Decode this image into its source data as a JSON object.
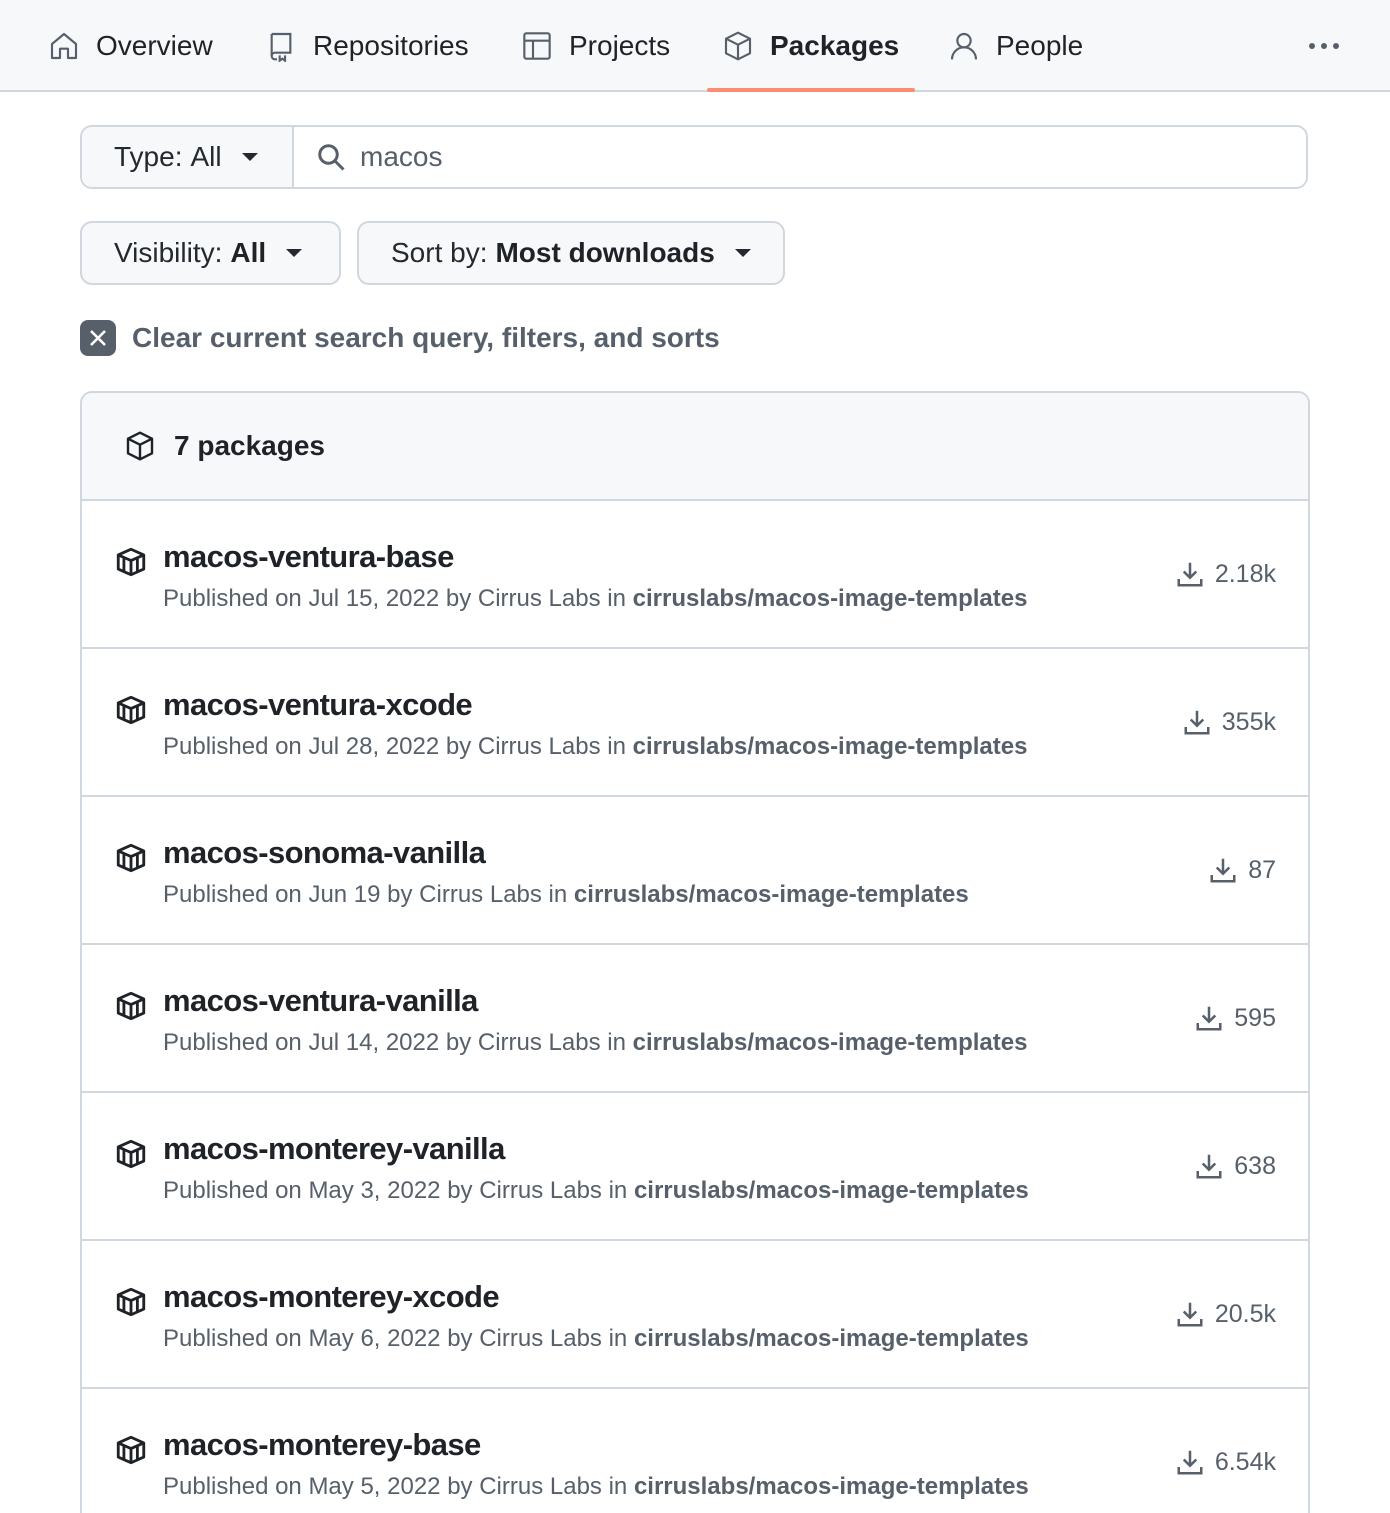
{
  "nav": {
    "items": [
      {
        "label": "Overview",
        "icon": "home-icon"
      },
      {
        "label": "Repositories",
        "icon": "repo-icon"
      },
      {
        "label": "Projects",
        "icon": "table-icon"
      },
      {
        "label": "Packages",
        "icon": "package-icon",
        "active": true
      },
      {
        "label": "People",
        "icon": "person-icon"
      }
    ],
    "more_icon": "kebab-horizontal-icon"
  },
  "filters": {
    "type_prefix": "Type:",
    "type_value": "All",
    "search_value": "macos",
    "visibility_prefix": "Visibility:",
    "visibility_value": "All",
    "sort_prefix": "Sort by:",
    "sort_value": "Most downloads",
    "clear_label": "Clear current search query, filters, and sorts"
  },
  "packages": {
    "count_label": "7 packages",
    "items": [
      {
        "name": "macos-ventura-base",
        "published": "Published on Jul 15, 2022 by Cirrus Labs in",
        "repo": "cirruslabs/macos-image-templates",
        "downloads": "2.18k"
      },
      {
        "name": "macos-ventura-xcode",
        "published": "Published on Jul 28, 2022 by Cirrus Labs in",
        "repo": "cirruslabs/macos-image-templates",
        "downloads": "355k"
      },
      {
        "name": "macos-sonoma-vanilla",
        "published": "Published on Jun 19 by Cirrus Labs in",
        "repo": "cirruslabs/macos-image-templates",
        "downloads": "87"
      },
      {
        "name": "macos-ventura-vanilla",
        "published": "Published on Jul 14, 2022 by Cirrus Labs in",
        "repo": "cirruslabs/macos-image-templates",
        "downloads": "595"
      },
      {
        "name": "macos-monterey-vanilla",
        "published": "Published on May 3, 2022 by Cirrus Labs in",
        "repo": "cirruslabs/macos-image-templates",
        "downloads": "638"
      },
      {
        "name": "macos-monterey-xcode",
        "published": "Published on May 6, 2022 by Cirrus Labs in",
        "repo": "cirruslabs/macos-image-templates",
        "downloads": "20.5k"
      },
      {
        "name": "macos-monterey-base",
        "published": "Published on May 5, 2022 by Cirrus Labs in",
        "repo": "cirruslabs/macos-image-templates",
        "downloads": "6.54k"
      }
    ]
  },
  "colors": {
    "accent_underline": "#fd8c73",
    "border": "#d0d7de",
    "muted_text": "#57606a",
    "header_bg": "#f6f8fa"
  }
}
